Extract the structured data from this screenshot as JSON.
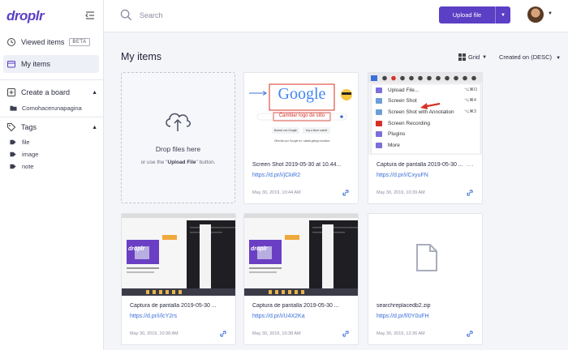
{
  "app": {
    "logo": "droplr"
  },
  "sidebar": {
    "viewed": "Viewed items",
    "beta": "BETA",
    "my_items": "My items",
    "create_board": "Create a board",
    "boards": [
      "Comohacerunapagina"
    ],
    "tags_title": "Tags",
    "tags": [
      "file",
      "image",
      "note"
    ]
  },
  "header": {
    "search_placeholder": "Search",
    "upload_label": "Upload file"
  },
  "main": {
    "title": "My items",
    "view_label": "Grid",
    "sort_label": "Created on (DESC)",
    "dropzone_title": "Drop files here",
    "dropzone_sub_prefix": "or use the \"",
    "dropzone_sub_bold": "Upload File",
    "dropzone_sub_suffix": "\" button."
  },
  "items": [
    {
      "name": "Screen Shot 2019-05-30 at 10.44...",
      "link": "https://d.pr/i/jCkiR2",
      "date": "May 30, 2019, 10:44 AM"
    },
    {
      "name": "Captura de pantalla 2019-05-30 ...",
      "link": "https://d.pr/i/CxyuFN",
      "date": "May 30, 2019, 10:39 AM"
    },
    {
      "name": "Captura de pantalla 2019-05-30 ...",
      "link": "https://d.pr/i/lcY2rs",
      "date": "May 30, 2019, 10:38 AM"
    },
    {
      "name": "Captura de pantalla 2019-05-30 ...",
      "link": "https://d.pr/i/U4X2Ka",
      "date": "May 30, 2019, 10:38 AM"
    },
    {
      "name": "searchreplacedb2.zip",
      "link": "https://d.pr/f/0Y0uFH",
      "date": "May 30, 2019, 12:36 AM"
    }
  ],
  "thumb_google": {
    "logo": "Google",
    "caption": "Cambiar logo de sitio",
    "btn1": "Buscar con Google",
    "btn2": "Voy a tener suerte",
    "footer": "Ofrecido por Google en: català galego euskara"
  },
  "thumb_menu": {
    "items": [
      "Upload File...",
      "Screen Shot",
      "Screen Shot with Annotation",
      "Screen Recording",
      "Plugins",
      "More"
    ],
    "shortcuts": [
      "⌥⌘O",
      "⌥⌘4",
      "⌥⌘3",
      "",
      "",
      ""
    ]
  },
  "colors": {
    "brand": "#5b3fc4",
    "link": "#3a6fd8"
  }
}
